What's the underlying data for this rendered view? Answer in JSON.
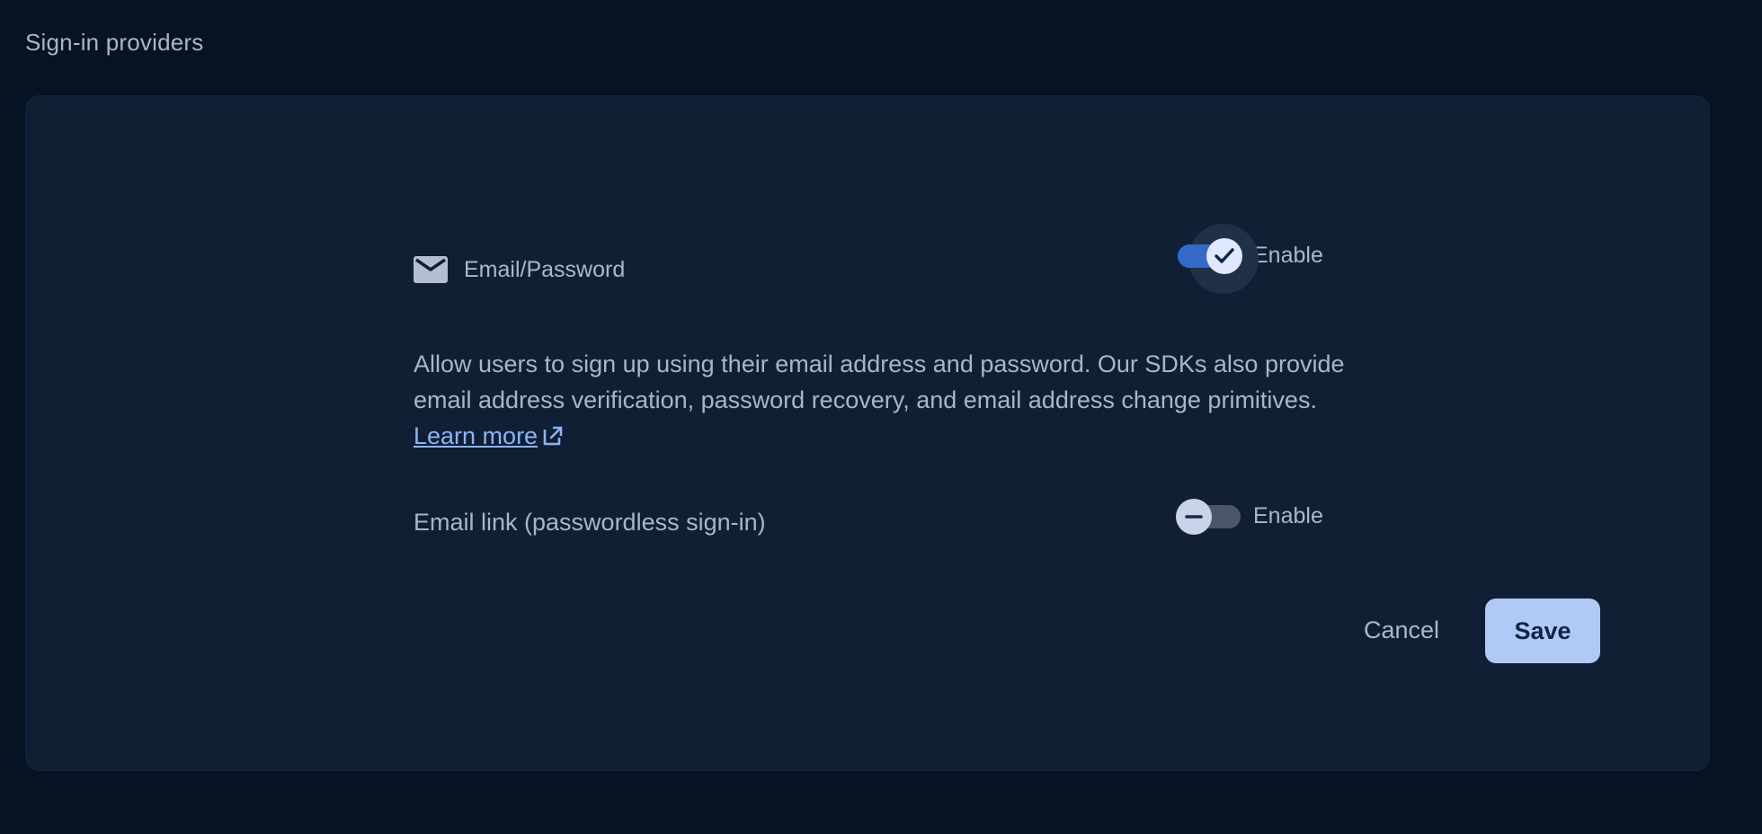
{
  "page": {
    "title": "Sign-in providers"
  },
  "provider": {
    "icon": "mail-icon",
    "name": "Email/Password",
    "enabled": true,
    "toggle_label": "Enable",
    "description": "Allow users to sign up using their email address and password. Our SDKs also provide email address verification, password recovery, and email address change primitives.",
    "learn_more_label": "Learn more",
    "learn_more_icon": "external-link-icon"
  },
  "email_link": {
    "label": "Email link (passwordless sign-in)",
    "enabled": false,
    "toggle_label": "Enable"
  },
  "actions": {
    "cancel_label": "Cancel",
    "save_label": "Save"
  },
  "colors": {
    "background": "#051322",
    "card": "#111f35",
    "toggle_on": "#3469c7",
    "toggle_off": "#4b5669",
    "link": "#8cb4f3",
    "save_button": "#b1c9f6"
  }
}
